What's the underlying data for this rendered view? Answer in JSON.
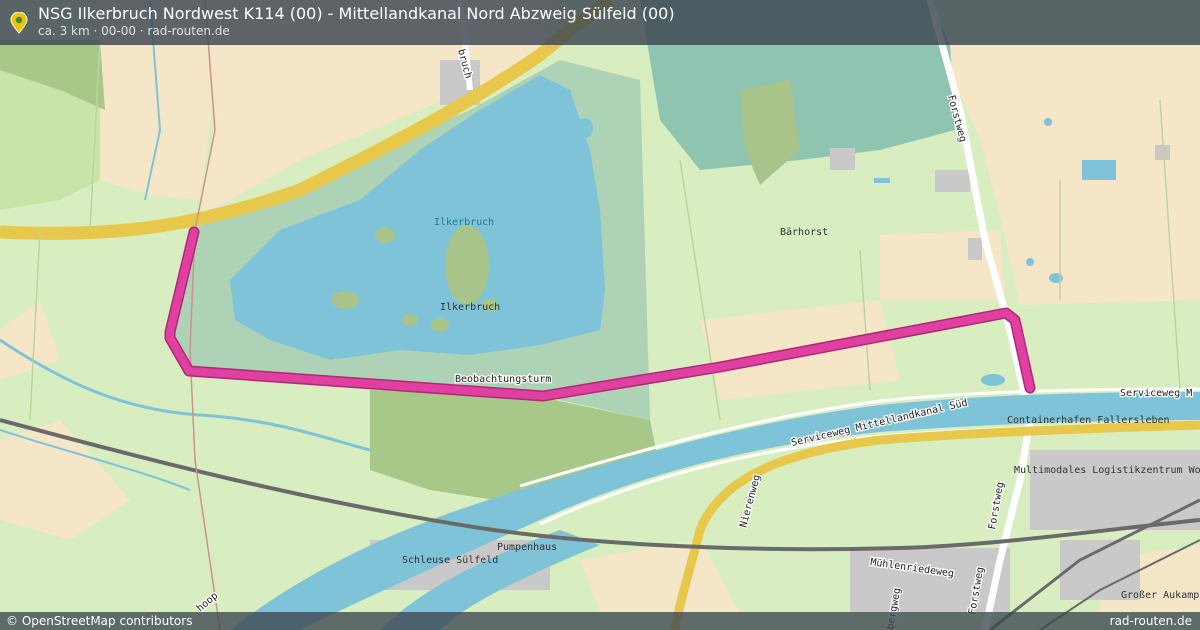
{
  "header": {
    "title": "NSG Ilkerbruch Nordwest K114 (00) - Mittellandkanal Nord Abzweig Sülfeld (00)",
    "subtitle": "ca. 3 km · 00-00 · rad-routen.de"
  },
  "footer": {
    "attribution": "© OpenStreetMap contributors",
    "brand": "rad-routen.de"
  },
  "labels": {
    "ilkerbruch_water": "Ilkerbruch",
    "ilkerbruch": "Ilkerbruch",
    "baerhorst": "Bärhorst",
    "beobachtungsturm": "Beobachtungsturm",
    "forstweg_north": "Forstweg",
    "forstweg_south": "Forstweg",
    "forstweg_bottom": "Forstweg",
    "serviceweg_m": "Serviceweg M",
    "serviceweg_sued": "Serviceweg Mittellandkanal Süd",
    "containerhafen": "Containerhafen Fallersleben",
    "logistikzentrum": "Multimodales Logistikzentrum Wo",
    "nierenweg": "Nierenweg",
    "muehlenriedeweg": "Mühlenriedeweg",
    "schleuse": "Schleuse Sülfeld",
    "pumpenhaus": "Pumpenhaus",
    "grosser_aukamp": "Großer Aukamp",
    "bergweg": "bergweg",
    "hoop": "hoop",
    "bruch": "bruch"
  },
  "colors": {
    "route": "#e040a0",
    "water": "#7ec3d8",
    "farmland": "#f5e6c8",
    "meadow": "#d8eec0",
    "forest": "#a8c88a",
    "motorway": "#e8c84a"
  }
}
